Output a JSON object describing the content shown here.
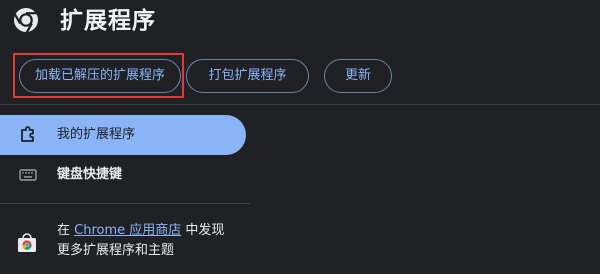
{
  "header": {
    "title": "扩展程序",
    "logo_icon": "chrome-logo-icon"
  },
  "toolbar": {
    "load_unpacked_label": "加载已解压的扩展程序",
    "pack_extension_label": "打包扩展程序",
    "update_label": "更新",
    "highlight_color": "#e53935"
  },
  "sidebar": {
    "items": [
      {
        "label": "我的扩展程序",
        "icon": "puzzle-piece-icon",
        "active": true
      },
      {
        "label": "键盘快捷键",
        "icon": "keyboard-icon",
        "active": false
      }
    ],
    "store_promo": {
      "prefix": "在 ",
      "link_text": "Chrome 应用商店",
      "middle": " 中发现",
      "line2": "更多扩展程序和主题",
      "icon": "chrome-web-store-icon"
    }
  },
  "colors": {
    "background": "#202124",
    "accent": "#8ab4f8",
    "text": "#e8eaed",
    "divider": "#3c4043"
  }
}
